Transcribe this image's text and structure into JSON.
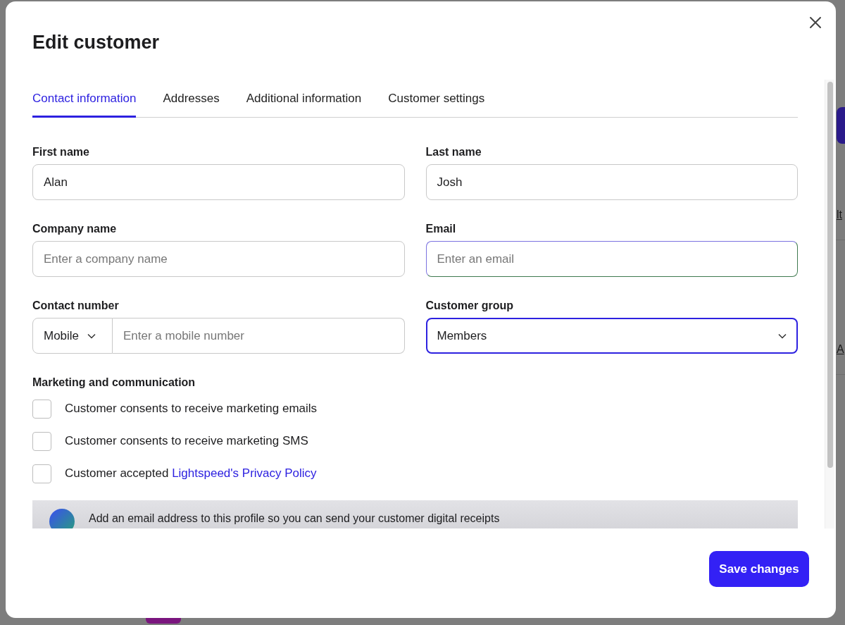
{
  "background_page": {
    "fragments": [
      "lt",
      "A"
    ]
  },
  "dialog": {
    "title": "Edit customer",
    "tabs": [
      {
        "label": "Contact information",
        "selected": true
      },
      {
        "label": "Addresses",
        "selected": false
      },
      {
        "label": "Additional information",
        "selected": false
      },
      {
        "label": "Customer settings",
        "selected": false
      }
    ],
    "fields": [
      {
        "kind": "text",
        "label": "First name",
        "value": "Alan",
        "focused": false,
        "hovered": false
      },
      {
        "kind": "text",
        "label": "Last name",
        "value": "Josh",
        "focused": false,
        "hovered": false
      },
      {
        "kind": "text",
        "label": "Company name",
        "placeholder": "Enter a company name",
        "focused": false,
        "hovered": false
      },
      {
        "kind": "text",
        "label": "Email",
        "placeholder": "Enter an email",
        "focused": false,
        "hovered": true
      },
      {
        "kind": "phone",
        "label": "Contact number",
        "type": "Mobile",
        "placeholder": "Enter a mobile number",
        "focused": false,
        "hovered": false
      },
      {
        "kind": "select",
        "label": "Customer group",
        "value": "Members",
        "focused": true,
        "hovered": false
      }
    ],
    "marketing": {
      "heading": "Marketing and communication",
      "checkboxes": [
        {
          "text": "Customer consents to receive marketing emails",
          "checked": false
        },
        {
          "text": "Customer consents to receive marketing SMS",
          "checked": false
        },
        {
          "text": "Customer accepted ",
          "link": "Lightspeed's Privacy Policy",
          "checked": false
        }
      ]
    },
    "banner": {
      "text": "Add an email address to this profile so you can send your customer digital receipts"
    },
    "save_button": "Save changes"
  }
}
